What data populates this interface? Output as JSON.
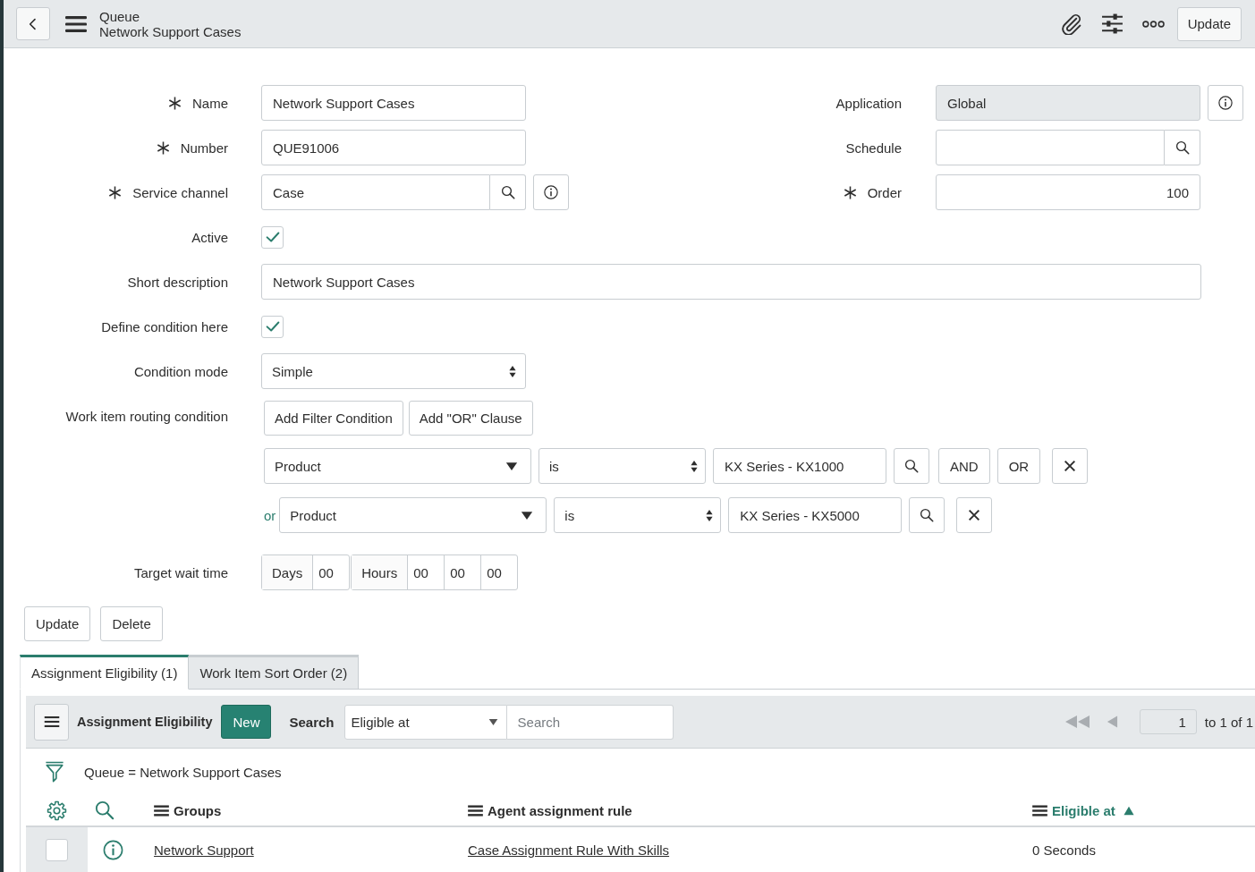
{
  "header": {
    "title": "Queue",
    "subtitle": "Network Support Cases",
    "buttons": [
      "Update"
    ]
  },
  "form": {
    "left_fields": [
      {
        "label": "Name",
        "required": true,
        "kind": "text",
        "value": "Network Support Cases",
        "info_button": false
      },
      {
        "label": "Number",
        "required": true,
        "kind": "text",
        "value": "QUE91006",
        "info_button": false
      },
      {
        "label": "Service channel",
        "required": true,
        "kind": "reference",
        "value": "Case",
        "info_button": true
      }
    ],
    "right_fields": [
      {
        "label": "Application",
        "required": false,
        "kind": "readonly",
        "value": "Global",
        "info_button": true
      },
      {
        "label": "Schedule",
        "required": false,
        "kind": "reference",
        "info_button": false
      },
      {
        "label": "Order",
        "required": true,
        "kind": "number",
        "value": "100",
        "info_button": false
      }
    ],
    "fields": [
      {
        "label": "Active",
        "kind": "checkbox",
        "checked": true
      },
      {
        "label": "Short description",
        "kind": "long_text",
        "value": "Network Support Cases"
      },
      {
        "label": "Define condition here",
        "kind": "checkbox",
        "checked": true
      },
      {
        "label": "Condition mode",
        "kind": "select",
        "value": "Simple"
      }
    ],
    "routing_condition": {
      "label": "Work item routing condition",
      "buttons": [
        "Add Filter Condition",
        "Add \"OR\" Clause"
      ],
      "conditions": [
        {
          "field": "Product",
          "operator": "is",
          "value": "KX Series - KX1000",
          "buttons": [
            "AND",
            "OR"
          ]
        },
        {
          "prefix": "or",
          "field": "Product",
          "operator": "is",
          "value": "KX Series - KX5000"
        }
      ]
    },
    "target_wait_time": {
      "label": "Target wait time",
      "groups": [
        {
          "unit": "Days",
          "values": [
            "00"
          ]
        },
        {
          "unit": "Hours",
          "values": [
            "00",
            "00",
            "00"
          ]
        }
      ]
    },
    "buttons": [
      "Update",
      "Delete"
    ]
  },
  "related_tabs": [
    {
      "label": "Assignment Eligibility (1)",
      "selected": true
    },
    {
      "label": "Work Item Sort Order (2)",
      "selected": false
    }
  ],
  "related_list": {
    "title": "Assignment Eligibility",
    "new_button": "New",
    "search_label": "Search",
    "search_column": "Eligible at",
    "search_field": {
      "placeholder": "Search"
    },
    "pagination": {
      "back_disabled": true,
      "page": "1",
      "range": "to 1 of 1"
    },
    "filter": "Queue = Network Support Cases",
    "columns": [
      {
        "label": "Groups",
        "sorted": false
      },
      {
        "label": "Agent assignment rule",
        "sorted": false
      },
      {
        "label": "Eligible at",
        "sorted": true
      }
    ],
    "rows": [
      {
        "checked": false,
        "cells": [
          {
            "kind": "link",
            "text": "Network Support"
          },
          {
            "kind": "link",
            "text": "Case Assignment Rule With Skills"
          },
          {
            "kind": "text",
            "text": "0 Seconds"
          }
        ]
      }
    ]
  }
}
